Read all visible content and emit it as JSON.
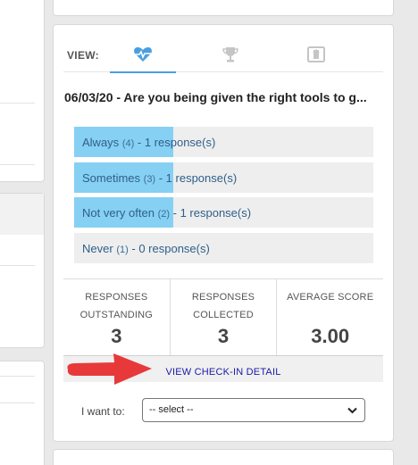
{
  "view_tabs": {
    "label": "VIEW:",
    "tabs": [
      {
        "name": "heart-pulse-icon",
        "active": true
      },
      {
        "name": "trophy-icon",
        "active": false
      },
      {
        "name": "export-icon",
        "active": false
      }
    ]
  },
  "question": "06/03/20 - Are you being given the right tools to g...",
  "answers": [
    {
      "label": "Always",
      "score": "(4)",
      "responses": "- 1 response(s)",
      "fill_fraction": 0.33
    },
    {
      "label": "Sometimes",
      "score": "(3)",
      "responses": "- 1 response(s)",
      "fill_fraction": 0.33
    },
    {
      "label": "Not very often",
      "score": "(2)",
      "responses": "- 1 response(s)",
      "fill_fraction": 0.33
    },
    {
      "label": "Never",
      "score": "(1)",
      "responses": "- 0 response(s)",
      "fill_fraction": 0
    }
  ],
  "stats": [
    {
      "line1": "RESPONSES",
      "line2": "OUTSTANDING",
      "value": "3"
    },
    {
      "line1": "RESPONSES",
      "line2": "COLLECTED",
      "value": "3"
    },
    {
      "line1": "AVERAGE SCORE",
      "line2": "",
      "value": "3.00"
    }
  ],
  "detail_link": "VIEW CHECK-IN DETAIL",
  "action": {
    "label": "I want to:",
    "selected": "-- select --"
  },
  "colors": {
    "bar_fill": "#86d0f3",
    "bar_bg": "#eeeeee",
    "accent_tab": "#4a9fe0",
    "arrow": "#e8393a",
    "link": "#1a1aa6"
  }
}
